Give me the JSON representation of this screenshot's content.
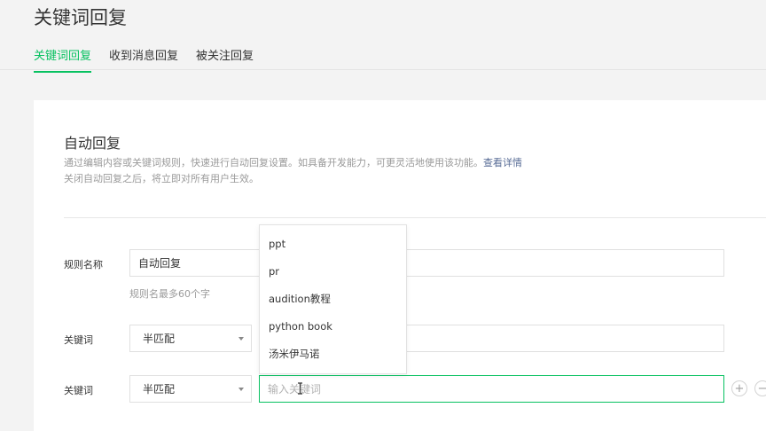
{
  "page": {
    "title": "关键词回复"
  },
  "tabs": [
    {
      "label": "关键词回复",
      "active": true
    },
    {
      "label": "收到消息回复",
      "active": false
    },
    {
      "label": "被关注回复",
      "active": false
    }
  ],
  "section": {
    "title": "自动回复",
    "desc_line1": "通过编辑内容或关键词规则，快速进行自动回复设置。如具备开发能力，可更灵活地使用该功能。",
    "details_link": "查看详情",
    "desc_line2": "关闭自动回复之后，将立即对所有用户生效。"
  },
  "rule_name": {
    "label": "规则名称",
    "value": "自动回复",
    "hint": "规则名最多60个字"
  },
  "keywords": [
    {
      "label": "关键词",
      "match": "半匹配",
      "value": ""
    },
    {
      "label": "关键词",
      "match": "半匹配",
      "value": "",
      "placeholder": "输入关键词",
      "focused": true
    }
  ],
  "suggestions": [
    "ppt",
    "pr",
    "audition教程",
    "python book",
    "汤米伊马诺"
  ],
  "buttons": {
    "add": "+",
    "remove": "−"
  },
  "colors": {
    "accent": "#07c160",
    "link": "#576b95",
    "background": "#f3f3f3"
  },
  "icons": {
    "dropdown": "chevron-down-icon",
    "text_cursor": "i-beam-cursor-icon"
  }
}
